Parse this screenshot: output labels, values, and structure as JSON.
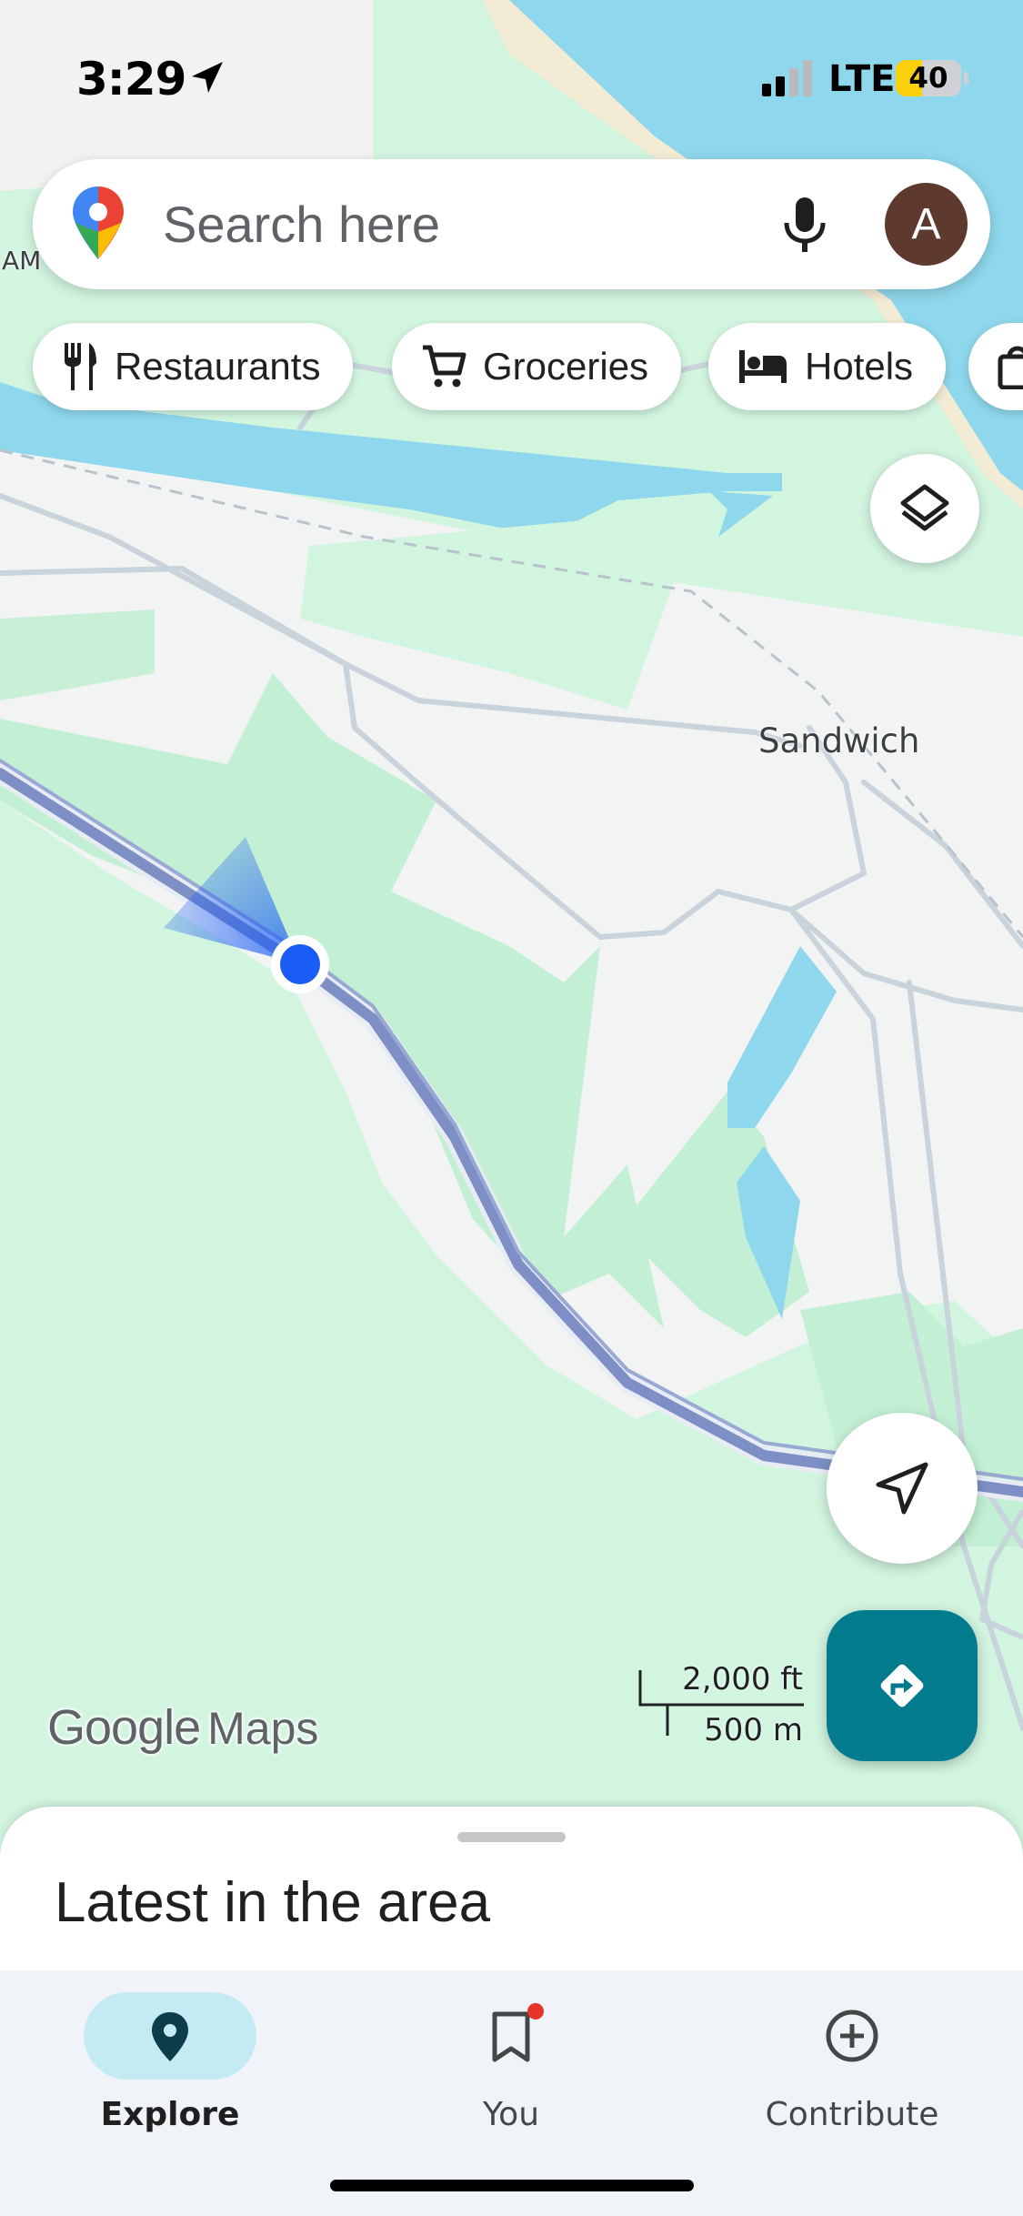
{
  "status_bar": {
    "time": "3:29",
    "network": "LTE",
    "battery_level": "40",
    "battery_fraction": 0.4
  },
  "search": {
    "placeholder": "Search here",
    "avatar_initial": "A"
  },
  "chips": [
    {
      "label": "Restaurants",
      "icon": "fork-knife-icon"
    },
    {
      "label": "Groceries",
      "icon": "cart-icon"
    },
    {
      "label": "Hotels",
      "icon": "bed-icon"
    },
    {
      "label": "",
      "icon": "shopping-bag-icon"
    }
  ],
  "map": {
    "place_labels": [
      "Sandwich",
      "AM"
    ],
    "scale": {
      "imperial": "2,000 ft",
      "metric": "500 m"
    },
    "logo": {
      "google": "Google",
      "maps": "Maps"
    }
  },
  "sheet": {
    "title": "Latest in the area"
  },
  "nav": {
    "items": [
      {
        "label": "Explore",
        "icon": "map-pin-icon",
        "active": true
      },
      {
        "label": "You",
        "icon": "bookmark-icon",
        "active": false
      },
      {
        "label": "Contribute",
        "icon": "plus-circle-icon",
        "active": false
      }
    ]
  },
  "colors": {
    "water": "#8fd7ec",
    "park": "#d2f5e0",
    "land": "#f2f3f3",
    "accent_teal": "#037b8f",
    "location_dot": "#1a5cf5"
  }
}
